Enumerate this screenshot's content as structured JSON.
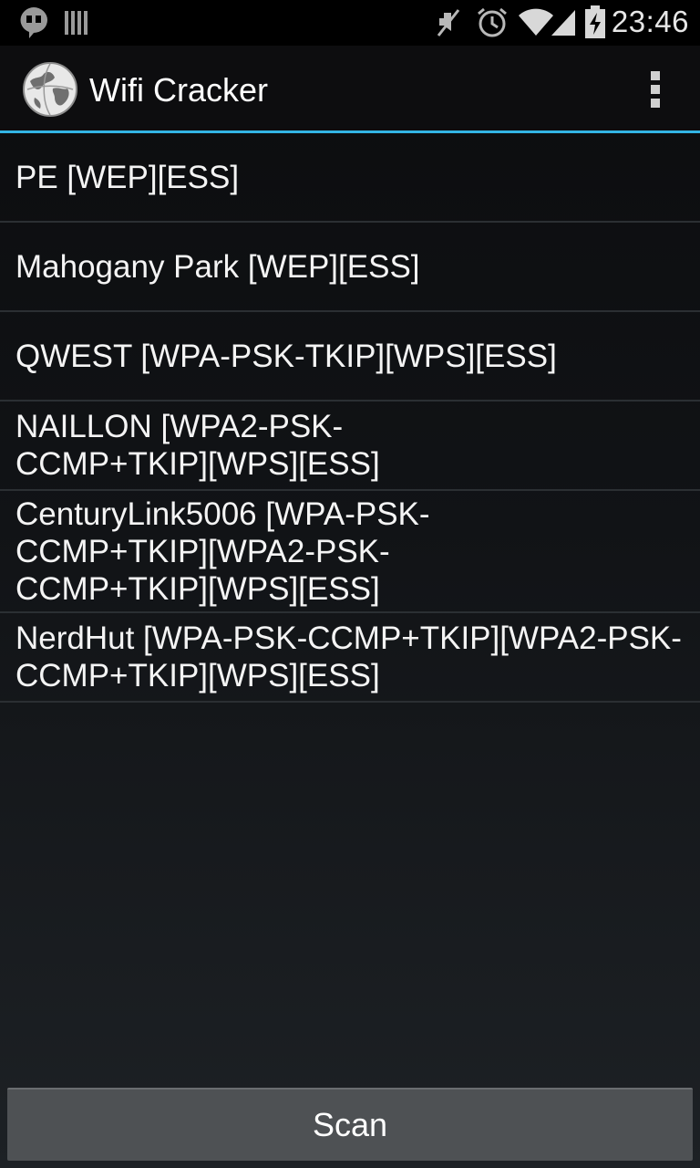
{
  "status_bar": {
    "time": "23:46",
    "icons": [
      "hangouts-icon",
      "barcode-icon",
      "mute-icon",
      "alarm-icon",
      "wifi-icon",
      "signal-icon",
      "battery-charging-icon"
    ]
  },
  "action_bar": {
    "title": "Wifi Cracker",
    "logo_icon": "globe-logo-icon",
    "overflow_icon": "overflow-menu-icon"
  },
  "networks": [
    "PE [WEP][ESS]",
    "Mahogany Park [WEP][ESS]",
    "QWEST [WPA-PSK-TKIP][WPS][ESS]",
    "NAILLON [WPA2-PSK-CCMP+TKIP][WPS][ESS]",
    "CenturyLink5006 [WPA-PSK-CCMP+TKIP][WPA2-PSK-CCMP+TKIP][WPS][ESS]",
    "NerdHut [WPA-PSK-CCMP+TKIP][WPA2-PSK-CCMP+TKIP][WPS][ESS]"
  ],
  "scan_button": {
    "label": "Scan"
  },
  "colors": {
    "accent": "#33b5e5",
    "background": "#111316",
    "button": "#4e5154"
  }
}
